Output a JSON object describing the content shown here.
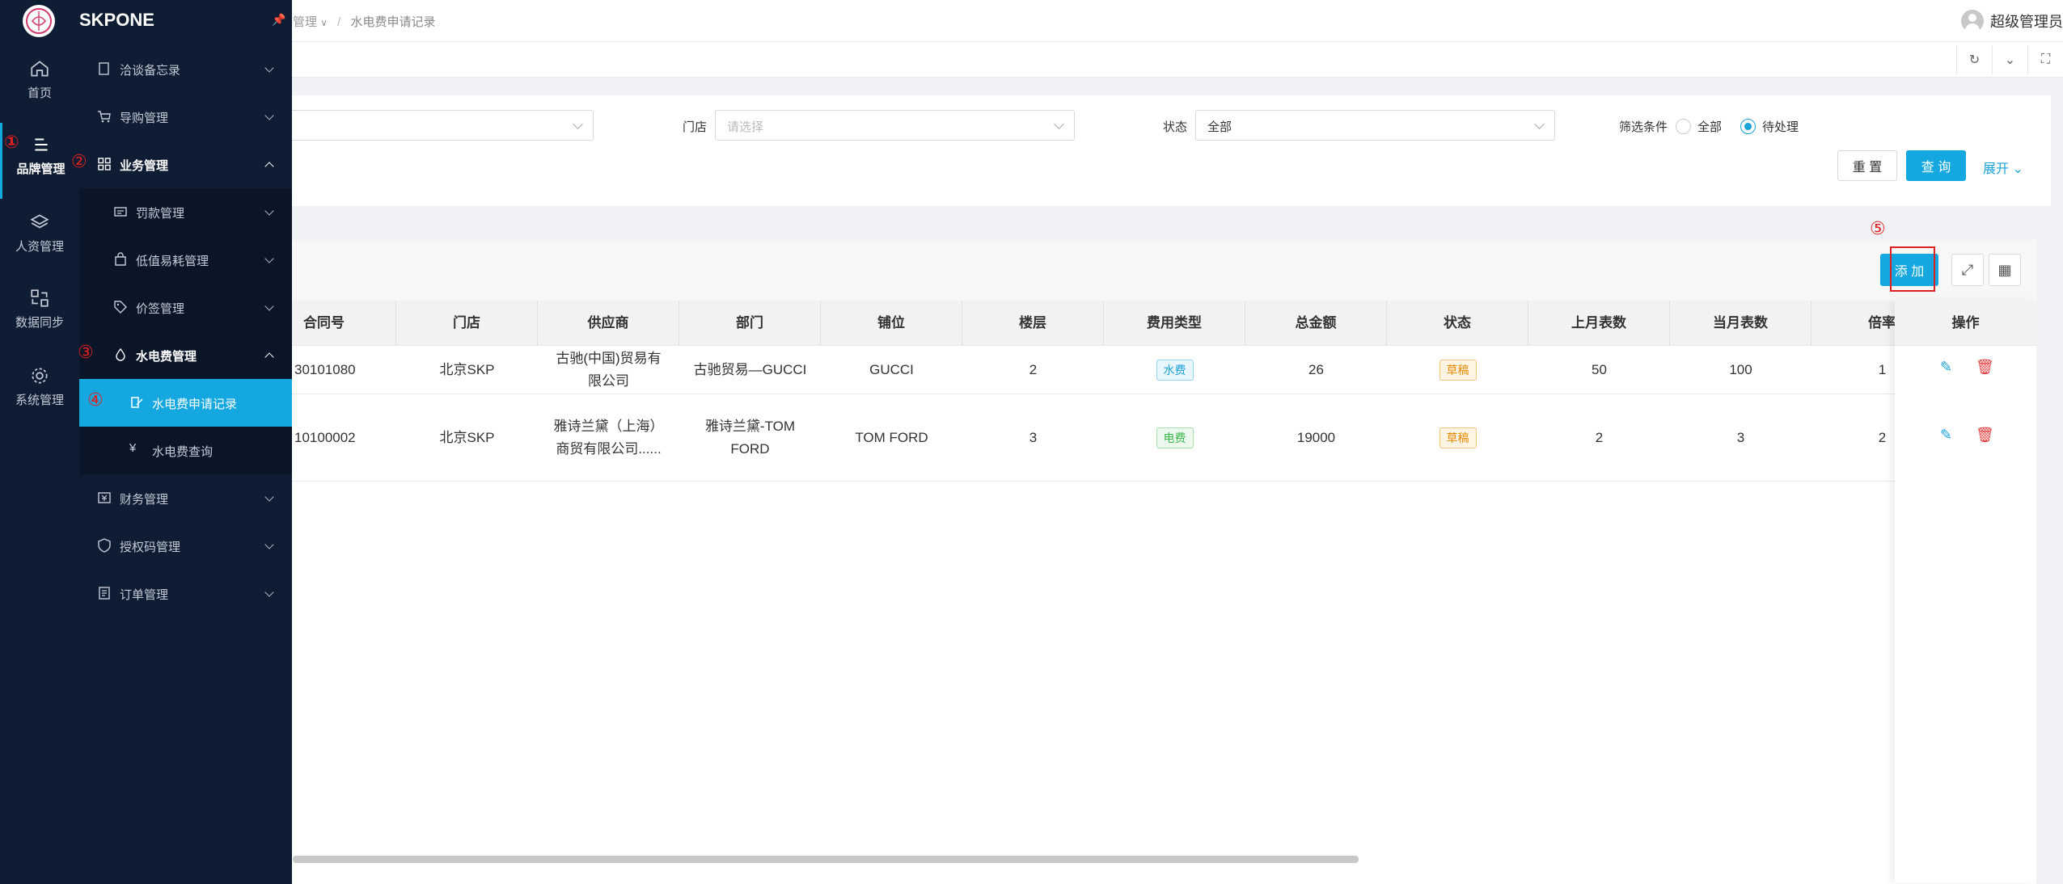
{
  "brand": {
    "name": "SKPONE"
  },
  "breadcrumb": {
    "parent": "管理",
    "separator": "/",
    "current": "水电费申请记录"
  },
  "user": {
    "name": "超级管理员"
  },
  "rail": [
    {
      "label": "首页",
      "icon": "home-icon"
    },
    {
      "label": "品牌管理",
      "icon": "list-icon",
      "active": true,
      "annotation": "①"
    },
    {
      "label": "人资管理",
      "icon": "layers-icon"
    },
    {
      "label": "数据同步",
      "icon": "sync-icon"
    },
    {
      "label": "系统管理",
      "icon": "gear-icon"
    }
  ],
  "menu": [
    {
      "label": "洽谈备忘录",
      "icon": "memo-icon"
    },
    {
      "label": "导购管理",
      "icon": "cart-icon"
    },
    {
      "label": "业务管理",
      "icon": "grid-icon",
      "open": true,
      "annotation": "②"
    },
    {
      "label": "罚款管理",
      "icon": "ticket-icon"
    },
    {
      "label": "低值易耗管理",
      "icon": "bag-icon"
    },
    {
      "label": "价签管理",
      "icon": "tag-icon"
    },
    {
      "label": "水电费管理",
      "icon": "drop-icon",
      "open": true,
      "annotation": "③"
    },
    {
      "label": "水电费申请记录",
      "icon": "edit-doc-icon",
      "active": true,
      "annotation": "④"
    },
    {
      "label": "水电费查询",
      "icon": "yen-icon"
    },
    {
      "label": "财务管理",
      "icon": "finance-icon"
    },
    {
      "label": "授权码管理",
      "icon": "shield-icon"
    },
    {
      "label": "订单管理",
      "icon": "order-icon"
    }
  ],
  "filters": {
    "store_label": "门店",
    "store_placeholder": "请选择",
    "status_label": "状态",
    "status_value": "全部",
    "condition_label": "筛选条件",
    "condition_all": "全部",
    "condition_pending": "待处理",
    "reset": "重 置",
    "query": "查 询",
    "expand": "展开"
  },
  "toolbar": {
    "add": "添 加",
    "annotation": "⑤"
  },
  "table": {
    "columns": [
      "合同号",
      "门店",
      "供应商",
      "部门",
      "铺位",
      "楼层",
      "费用类型",
      "总金额",
      "状态",
      "上月表数",
      "当月表数",
      "倍率"
    ],
    "op_header": "操作",
    "rows": [
      {
        "contract": "30101080",
        "store": "北京SKP",
        "supplier": "古驰(中国)贸易有限公司",
        "dept": "古驰贸易—GUCCI",
        "shop": "GUCCI",
        "floor": "2",
        "fee_type": "水费",
        "fee_color": "blue",
        "total": "26",
        "status": "草稿",
        "last": "50",
        "current": "100",
        "ratio": "1"
      },
      {
        "contract": "10100002",
        "store": "北京SKP",
        "supplier": "雅诗兰黛（上海）商贸有限公司......",
        "dept": "雅诗兰黛-TOM FORD",
        "shop": "TOM FORD",
        "floor": "3",
        "fee_type": "电费",
        "fee_color": "green",
        "total": "19000",
        "status": "草稿",
        "last": "2",
        "current": "3",
        "ratio": "2"
      }
    ]
  },
  "colors": {
    "primary": "#14a7e0",
    "sidebar": "#0e1d33",
    "annotation": "#e02020"
  }
}
